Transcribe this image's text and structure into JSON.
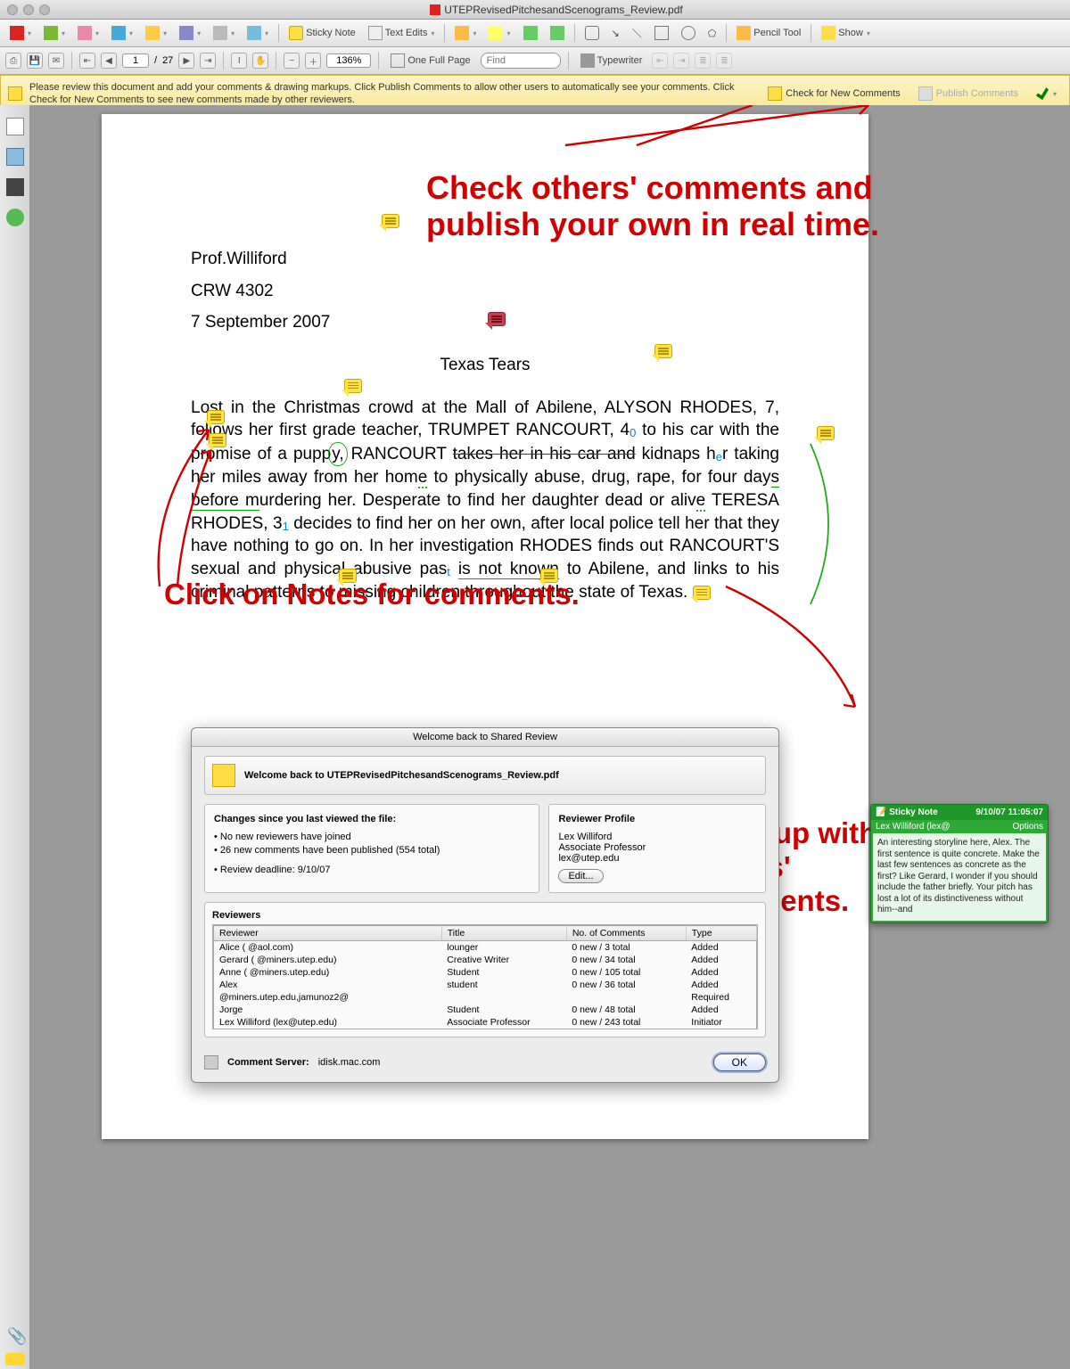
{
  "window": {
    "title": "UTEPRevisedPitchesandScenograms_Review.pdf"
  },
  "toolbar1": {
    "sticky_note": "Sticky Note",
    "text_edits": "Text Edits",
    "pencil_tool": "Pencil Tool",
    "show": "Show"
  },
  "toolbar2": {
    "page_current": "1",
    "page_sep": "/",
    "page_total": "27",
    "zoom_pct": "136%",
    "one_full_page": "One Full Page",
    "find_placeholder": "Find",
    "typewriter": "Typewriter"
  },
  "review_bar": {
    "msg": "Please review this document and add your comments & drawing markups. Click Publish Comments to allow other users to automatically see your comments. Click Check for New Comments to see new comments made by other reviewers.",
    "check": "Check for New Comments",
    "publish": "Publish Comments"
  },
  "document": {
    "prof": "Prof.Williford",
    "course": "CRW 4302",
    "date": "7 September 2007",
    "title": "Texas Tears",
    "para": "Lost in the Christmas crowd at the Mall of Abilene, ALYSON RHODES, 7, follows her first grade teacher, TRUMPET RANCOURT, 40 to his car with the promise of a puppy, RANCOURT takes her in his car and kidnaps her taking her miles away from her home to physically abuse, drug, rape, for four days before murdering her. Desperate to find her daughter dead or alive TERESA RHODES, 31 decides to find her on her own, after local police tell her that they have nothing to go on. In her investigation RHODES finds out RANCOURT'S sexual and physical abusive past is not known to Abilene, and links to his criminal patterns to missing children throughout the state of Texas."
  },
  "annos": {
    "a1": "Check others' comments and publish your own in real time.",
    "a2": "Click on Notes for comments.",
    "a3": "Keep up with others' comments."
  },
  "dialog": {
    "title": "Welcome back to Shared Review",
    "welcome": "Welcome back to UTEPRevisedPitchesandScenograms_Review.pdf",
    "changes_hdr": "Changes since you last viewed the file:",
    "changes": [
      "No new reviewers have joined",
      "26 new comments have been published (554 total)",
      "Review deadline: 9/10/07"
    ],
    "profile_hdr": "Reviewer Profile",
    "profile_name": "Lex Williford",
    "profile_title": "Associate Professor",
    "profile_email": "lex@utep.edu",
    "edit": "Edit...",
    "reviewers_hdr": "Reviewers",
    "cols": {
      "reviewer": "Reviewer",
      "title": "Title",
      "comments": "No. of Comments",
      "type": "Type"
    },
    "rows": [
      {
        "r": "Alice (            @aol.com)",
        "t": "lounger",
        "c": "0 new / 3 total",
        "y": "Added"
      },
      {
        "r": "Gerard (        @miners.utep.edu)",
        "t": "Creative Writer",
        "c": "0 new / 34 total",
        "y": "Added"
      },
      {
        "r": "Anne  (         @miners.utep.edu)",
        "t": "Student",
        "c": "0 new / 105 total",
        "y": "Added"
      },
      {
        "r": "Alex",
        "t": "student",
        "c": "0 new / 36 total",
        "y": "Added"
      },
      {
        "r": "        @miners.utep.edu,jamunoz2@",
        "t": "",
        "c": "",
        "y": "Required"
      },
      {
        "r": "Jorge",
        "t": "Student",
        "c": "0 new / 48 total",
        "y": "Added"
      },
      {
        "r": "Lex Williford (lex@utep.edu)",
        "t": "Associate Professor",
        "c": "0 new / 243 total",
        "y": "Initiator"
      }
    ],
    "server_lbl": "Comment Server:",
    "server_val": "idisk.mac.com",
    "ok": "OK"
  },
  "note_popup": {
    "head": "Sticky Note",
    "date": "9/10/07 11:05:07",
    "author": "Lex Williford (lex@",
    "options": "Options",
    "body": "An interesting storyline here, Alex. The first sentence is quite concrete. Make the last few sentences as concrete as the first?  Like Gerard, I wonder if you should include the father briefly.  Your pitch has lost a lot of its distinctiveness without him--and"
  }
}
